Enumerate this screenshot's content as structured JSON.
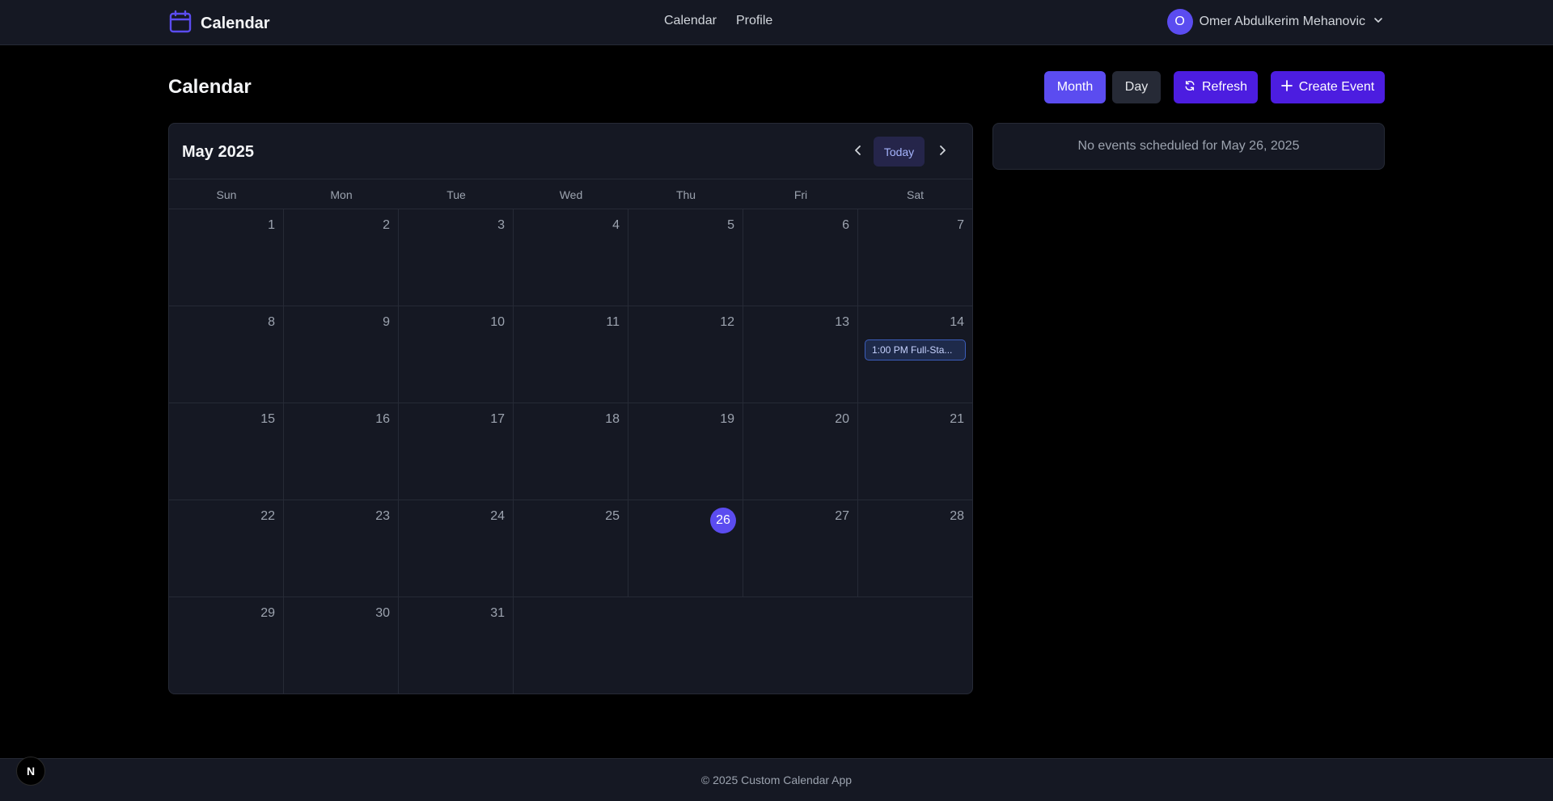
{
  "navbar": {
    "brand": "Calendar",
    "links": [
      "Calendar",
      "Profile"
    ],
    "user": {
      "initial": "O",
      "name": "Omer Abdulkerim Mehanovic"
    }
  },
  "page": {
    "title": "Calendar"
  },
  "toolbar": {
    "month": "Month",
    "day": "Day",
    "refresh": "Refresh",
    "create": "Create Event"
  },
  "calendar": {
    "month_label": "May 2025",
    "today_label": "Today",
    "weekdays": [
      "Sun",
      "Mon",
      "Tue",
      "Wed",
      "Thu",
      "Fri",
      "Sat"
    ],
    "today": 26,
    "days": [
      1,
      2,
      3,
      4,
      5,
      6,
      7,
      8,
      9,
      10,
      11,
      12,
      13,
      14,
      15,
      16,
      17,
      18,
      19,
      20,
      21,
      22,
      23,
      24,
      25,
      26,
      27,
      28,
      29,
      30,
      31
    ],
    "events": [
      {
        "day": 14,
        "label": "1:00 PM Full-Sta..."
      }
    ]
  },
  "side_panel": {
    "message": "No events scheduled for May 26, 2025"
  },
  "footer": {
    "text": "© 2025 Custom Calendar App"
  },
  "badge": {
    "label": "N"
  },
  "colors": {
    "accent": "#5b4cf0",
    "primary": "#4c1de0",
    "surface": "#151823",
    "border": "#262a36"
  }
}
